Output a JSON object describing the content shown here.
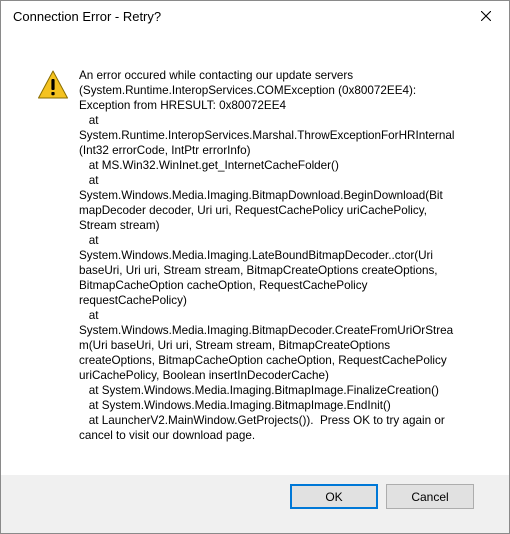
{
  "window": {
    "title": "Connection Error - Retry?"
  },
  "dialog": {
    "icon": "warning-icon",
    "message_lines": [
      "An error occured while contacting our update servers",
      "(System.Runtime.InteropServices.COMException (0x80072EE4):",
      "Exception from HRESULT: 0x80072EE4",
      "   at",
      "System.Runtime.InteropServices.Marshal.ThrowExceptionForHRInternal",
      "(Int32 errorCode, IntPtr errorInfo)",
      "   at MS.Win32.WinInet.get_InternetCacheFolder()",
      "   at",
      "System.Windows.Media.Imaging.BitmapDownload.BeginDownload(Bit",
      "mapDecoder decoder, Uri uri, RequestCachePolicy uriCachePolicy,",
      "Stream stream)",
      "   at",
      "System.Windows.Media.Imaging.LateBoundBitmapDecoder..ctor(Uri",
      "baseUri, Uri uri, Stream stream, BitmapCreateOptions createOptions,",
      "BitmapCacheOption cacheOption, RequestCachePolicy",
      "requestCachePolicy)",
      "   at",
      "System.Windows.Media.Imaging.BitmapDecoder.CreateFromUriOrStrea",
      "m(Uri baseUri, Uri uri, Stream stream, BitmapCreateOptions",
      "createOptions, BitmapCacheOption cacheOption, RequestCachePolicy",
      "uriCachePolicy, Boolean insertInDecoderCache)",
      "   at System.Windows.Media.Imaging.BitmapImage.FinalizeCreation()",
      "   at System.Windows.Media.Imaging.BitmapImage.EndInit()",
      "   at LauncherV2.MainWindow.GetProjects()).  Press OK to try again or",
      "cancel to visit our download page."
    ]
  },
  "buttons": {
    "ok_label": "OK",
    "cancel_label": "Cancel"
  },
  "colors": {
    "warning_fill": "#f4c220",
    "focus_border": "#0078d7",
    "footer_bg": "#f0f0f0"
  }
}
